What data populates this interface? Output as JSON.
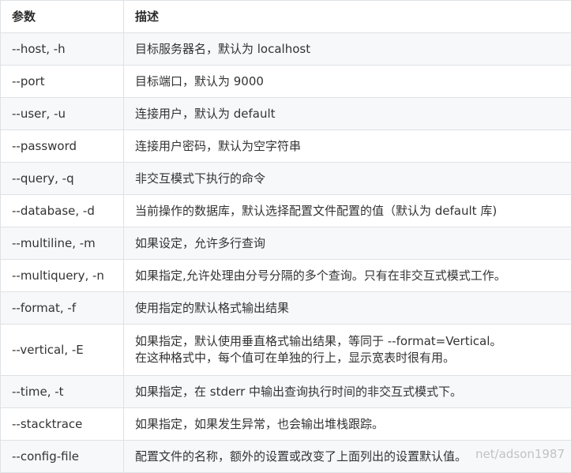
{
  "table": {
    "headers": [
      "参数",
      "描述"
    ],
    "rows": [
      {
        "param": "--host, -h",
        "desc": [
          "目标服务器名，默认为 localhost"
        ]
      },
      {
        "param": "--port",
        "desc": [
          "目标端口，默认为 9000"
        ]
      },
      {
        "param": "--user, -u",
        "desc": [
          "连接用户，默认为 default"
        ]
      },
      {
        "param": "--password",
        "desc": [
          "连接用户密码，默认为空字符串"
        ]
      },
      {
        "param": "--query, -q",
        "desc": [
          "非交互模式下执行的命令"
        ]
      },
      {
        "param": "--database, -d",
        "desc": [
          "当前操作的数据库，默认选择配置文件配置的值（默认为 default 库)"
        ]
      },
      {
        "param": "--multiline, -m",
        "desc": [
          "如果设定，允许多行查询"
        ]
      },
      {
        "param": "--multiquery, -n",
        "desc": [
          "如果指定,允许处理由分号分隔的多个查询。只有在非交互式模式工作。"
        ]
      },
      {
        "param": "--format, -f",
        "desc": [
          "使用指定的默认格式输出结果"
        ]
      },
      {
        "param": "--vertical, -E",
        "desc": [
          "如果指定，默认使用垂直格式输出结果，等同于 --format=Vertical。",
          "在这种格式中，每个值可在单独的行上，显示宽表时很有用。"
        ]
      },
      {
        "param": "--time, -t",
        "desc": [
          "如果指定，在 stderr 中输出查询执行时间的非交互式模式下。"
        ]
      },
      {
        "param": "--stacktrace",
        "desc": [
          "如果指定，如果发生异常，也会输出堆栈跟踪。"
        ]
      },
      {
        "param": "--config-file",
        "desc": [
          "配置文件的名称，额外的设置或改变了上面列出的设置默认值。"
        ]
      }
    ]
  },
  "watermark": "net/adson1987"
}
